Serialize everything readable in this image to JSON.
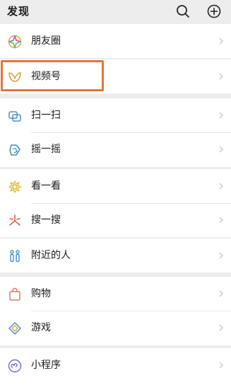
{
  "header": {
    "title": "发现"
  },
  "groups": [
    {
      "items": [
        {
          "label": "朋友圈",
          "icon": "moments-icon"
        }
      ]
    },
    {
      "items": [
        {
          "label": "视频号",
          "icon": "channels-icon"
        }
      ]
    },
    {
      "items": [
        {
          "label": "扫一扫",
          "icon": "scan-icon"
        },
        {
          "label": "摇一摇",
          "icon": "shake-icon"
        }
      ]
    },
    {
      "items": [
        {
          "label": "看一看",
          "icon": "top-stories-icon"
        },
        {
          "label": "搜一搜",
          "icon": "search-star-icon"
        }
      ]
    },
    {
      "items": [
        {
          "label": "附近的人",
          "icon": "people-nearby-icon"
        }
      ]
    },
    {
      "items": [
        {
          "label": "购物",
          "icon": "shopping-bag-icon"
        },
        {
          "label": "游戏",
          "icon": "games-icon"
        }
      ]
    },
    {
      "items": [
        {
          "label": "小程序",
          "icon": "mini-programs-icon"
        }
      ]
    }
  ],
  "colors": {
    "highlight_border": "#e8733b",
    "background": "#ededed"
  }
}
